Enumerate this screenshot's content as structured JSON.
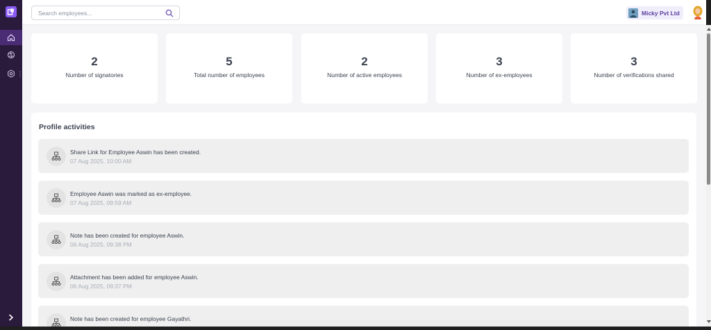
{
  "search": {
    "placeholder": "Search employees..."
  },
  "company": {
    "name": "Micky Pvt Ltd"
  },
  "stats": [
    {
      "value": "2",
      "label": "Number of signatories"
    },
    {
      "value": "5",
      "label": "Total number of employees"
    },
    {
      "value": "2",
      "label": "Number of active employees"
    },
    {
      "value": "3",
      "label": "Number of ex-employees"
    },
    {
      "value": "3",
      "label": "Number of verifications shared"
    }
  ],
  "activities": {
    "title": "Profile activities",
    "items": [
      {
        "text": "Share Link for Employee Aswin has been created.",
        "time": "07 Aug 2025, 10:00 AM"
      },
      {
        "text": "Employee Aswin was marked as ex-employee.",
        "time": "07 Aug 2025, 09:59 AM"
      },
      {
        "text": "Note has been created for employee Aswin.",
        "time": "06 Aug 2025, 09:38 PM"
      },
      {
        "text": "Attachment has been added for employee Aswin.",
        "time": "06 Aug 2025, 09:37 PM"
      },
      {
        "text": "Note has been created for employee Gayathri.",
        "time": ""
      }
    ]
  },
  "icons": {
    "sidebar": [
      "home-icon",
      "globe-icon",
      "gear-icon"
    ],
    "activity": "org-chart-icon"
  },
  "colors": {
    "sidebar": "#2a1b3d",
    "accent": "#8b5cf6",
    "active_nav": "#4a2c74"
  }
}
